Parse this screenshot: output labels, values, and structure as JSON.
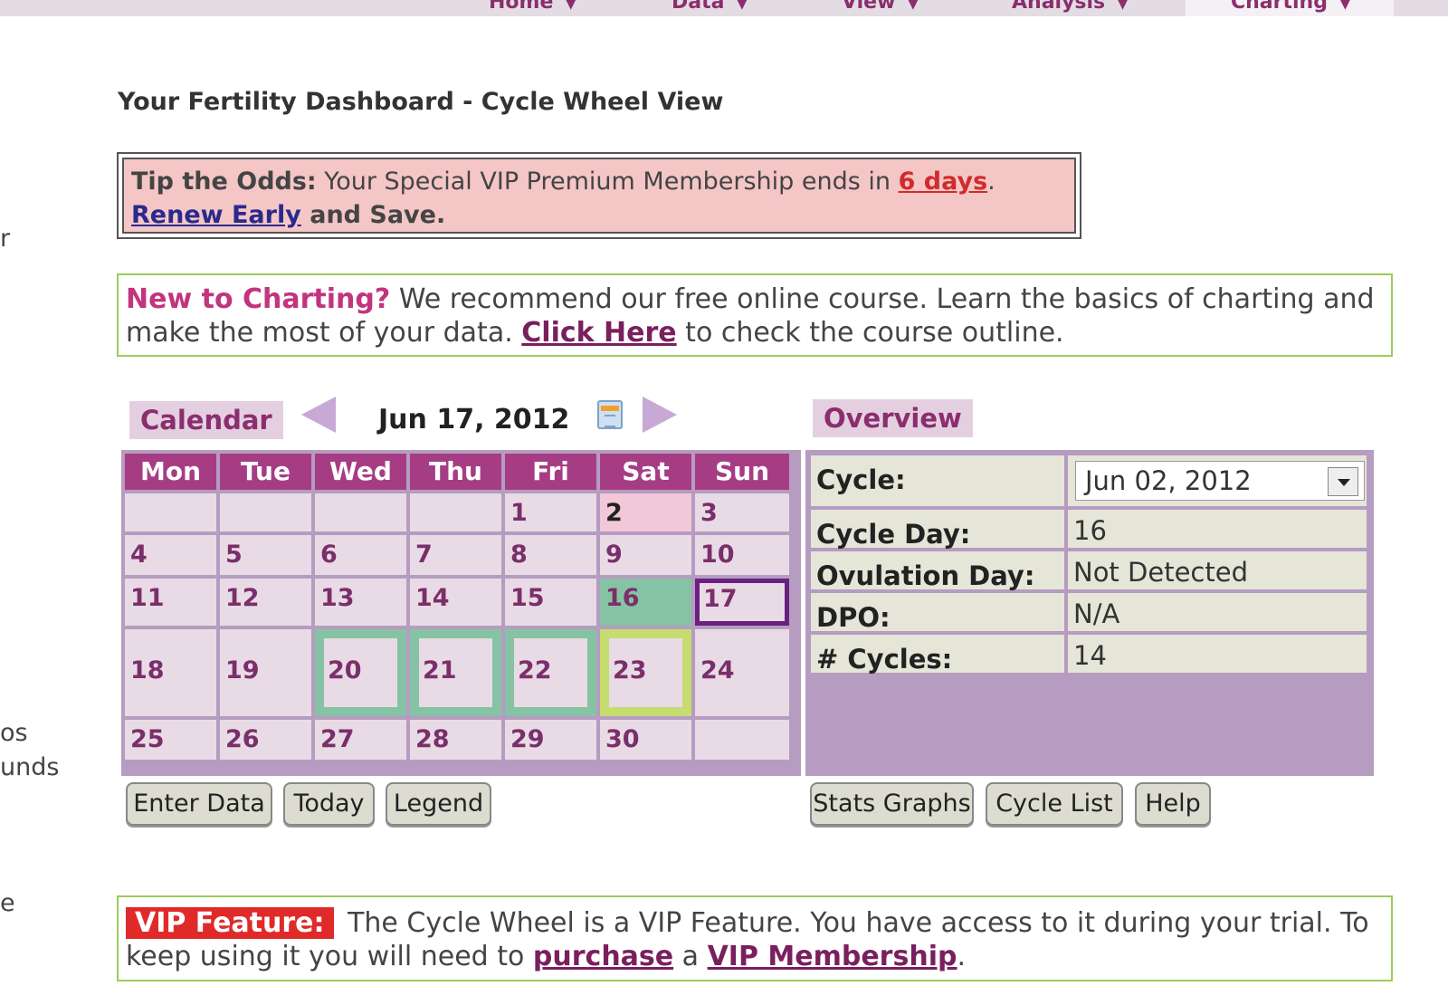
{
  "nav": {
    "items": [
      {
        "label": "Home"
      },
      {
        "label": "Data"
      },
      {
        "label": "View"
      },
      {
        "label": "Analysis"
      },
      {
        "label": "Charting"
      }
    ]
  },
  "sidebar_fragments": [
    "r",
    "os",
    "unds",
    "e"
  ],
  "page_title": "Your Fertility Dashboard - Cycle Wheel View",
  "tip": {
    "heading": "Tip the Odds:",
    "text": " Your Special VIP Premium Membership ends in ",
    "days_link": "6 days",
    "period": ".",
    "renew_link": "Renew Early",
    "tail": " and Save."
  },
  "new_charting": {
    "heading": "New to Charting?",
    "text": " We recommend our free online course. Learn the basics of charting and make the most of your data. ",
    "link": "Click Here",
    "tail": " to check the course outline."
  },
  "calendar": {
    "tab_label": "Calendar",
    "date": "Jun 17, 2012",
    "weekdays": [
      "Mon",
      "Tue",
      "Wed",
      "Thu",
      "Fri",
      "Sat",
      "Sun"
    ],
    "weeks": [
      [
        "",
        "",
        "",
        "",
        "1",
        "2",
        "3"
      ],
      [
        "4",
        "5",
        "6",
        "7",
        "8",
        "9",
        "10"
      ],
      [
        "11",
        "12",
        "13",
        "14",
        "15",
        "16",
        "17"
      ],
      [
        "18",
        "19",
        "20",
        "21",
        "22",
        "23",
        "24"
      ],
      [
        "25",
        "26",
        "27",
        "28",
        "29",
        "30",
        ""
      ]
    ],
    "colors": {
      "header": "#a63d84",
      "cell": "#e9dbe6",
      "period": "#f2c7d8",
      "fertile": "#86c2a4",
      "ovulation": "#c6dc6e",
      "today": "#6a2080"
    }
  },
  "overview": {
    "tab_label": "Overview",
    "rows": [
      {
        "label": "Cycle:",
        "value": "Jun 02, 2012"
      },
      {
        "label": "Cycle Day:",
        "value": "16"
      },
      {
        "label": "Ovulation Day:",
        "value": "Not Detected"
      },
      {
        "label": "DPO:",
        "value": "N/A"
      },
      {
        "label": "# Cycles:",
        "value": "14"
      }
    ]
  },
  "buttons": {
    "enter_data": "Enter Data",
    "today": "Today",
    "legend": "Legend",
    "stats_graphs": "Stats Graphs",
    "cycle_list": "Cycle List",
    "help": "Help"
  },
  "vip": {
    "badge": "VIP Feature:",
    "text": " The Cycle Wheel is a VIP Feature. You have access to it during your trial. To keep using it you will need to ",
    "purchase_link": "purchase",
    "mid": " a ",
    "membership_link": "VIP Membership",
    "tail": "."
  }
}
